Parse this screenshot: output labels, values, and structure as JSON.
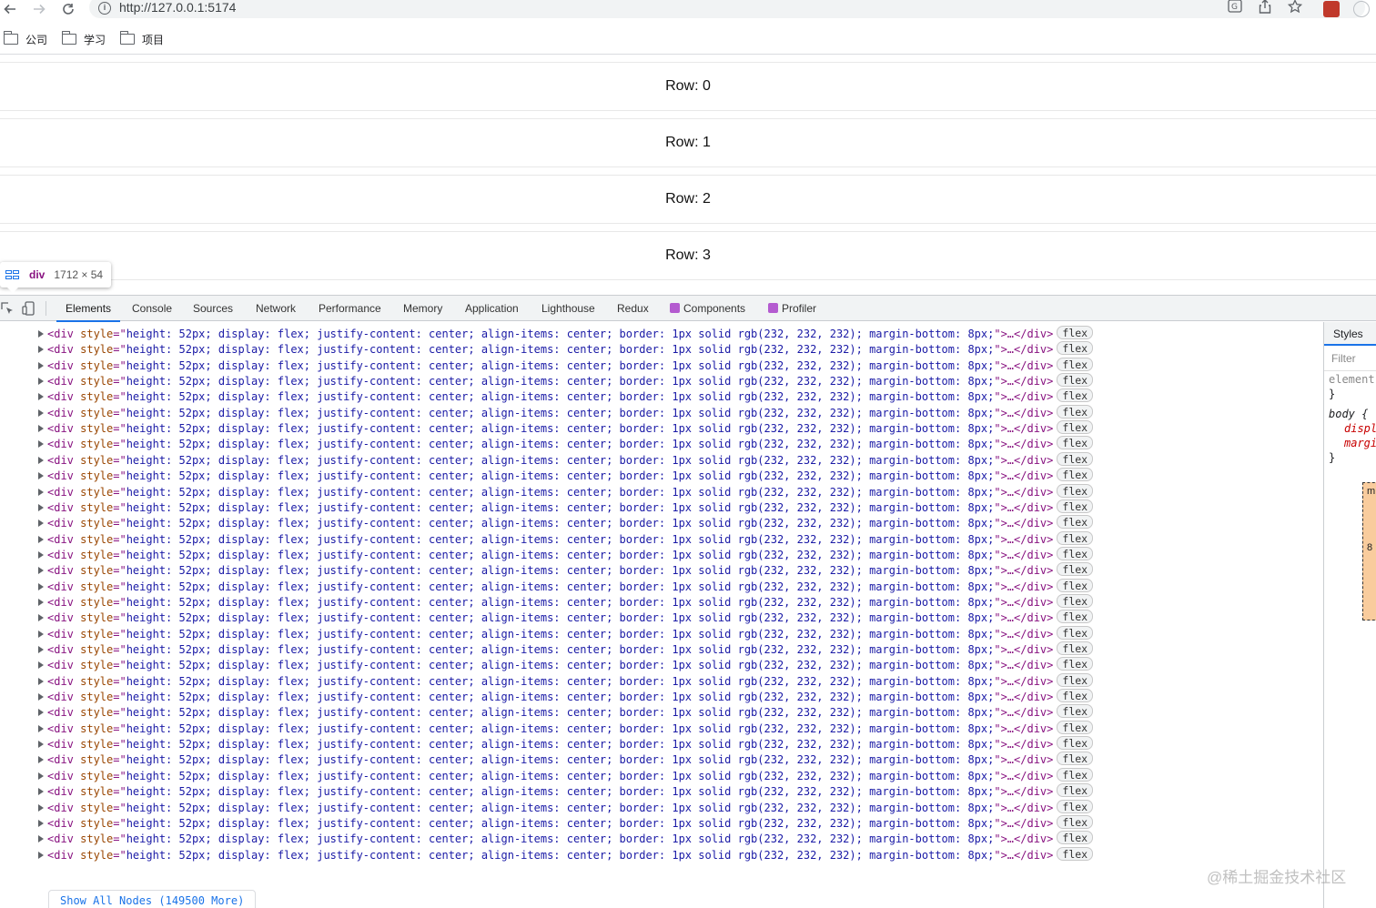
{
  "browser": {
    "url": "http://127.0.0.1:5174",
    "bookmarks": [
      "公司",
      "学习",
      "项目"
    ]
  },
  "page": {
    "rows": [
      "Row: 0",
      "Row: 1",
      "Row: 2",
      "Row: 3"
    ]
  },
  "tooltip": {
    "tag": "div",
    "size": "1712 × 54"
  },
  "devtools": {
    "tabs": [
      "Elements",
      "Console",
      "Sources",
      "Network",
      "Performance",
      "Memory",
      "Application",
      "Lighthouse",
      "Redux",
      "Components",
      "Profiler"
    ],
    "active_tab": "Elements",
    "dom_line": {
      "open": "<div ",
      "attr": "style",
      "eq": "=\"",
      "value": "height: 52px; display: flex; justify-content: center; align-items: center; border: 1px solid rgb(232, 232, 232); margin-bottom: 8px;",
      "close": "\">…</div>",
      "badge": "flex"
    },
    "visible_line_count": 34,
    "show_all_label": "Show All Nodes (149500 More)",
    "closing_tag": "</div>",
    "styles": {
      "tab": "Styles",
      "filter_placeholder": "Filter",
      "lines": [
        "element",
        "}",
        "body {",
        "displ",
        "margi",
        "}"
      ],
      "box_model_label": "m",
      "box_model_value": "8"
    }
  },
  "watermark": "@稀土掘金技术社区"
}
